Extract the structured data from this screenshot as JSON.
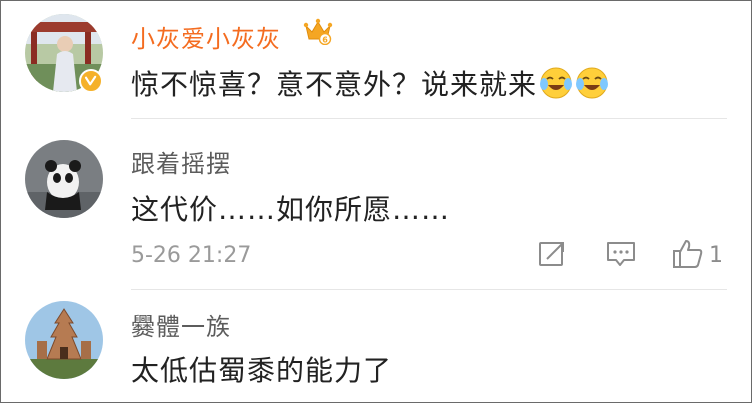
{
  "comments": [
    {
      "username": "小灰爱小灰灰",
      "username_color": "#f46c20",
      "text": "惊不惊喜？意不意外？说来就来",
      "emojis": [
        "laugh-cry-icon",
        "laugh-cry-icon"
      ],
      "verified_badge": "v-badge-icon",
      "vip_badge": "crown-icon"
    },
    {
      "username": "跟着摇摆",
      "username_color": "#5c5c5c",
      "text": "这代价……如你所愿……",
      "timestamp": "5-26 21:27",
      "actions": {
        "share_icon": "forward-icon",
        "comment_icon": "comment-icon",
        "like_icon": "thumbs-up-icon",
        "like_count": "1"
      }
    },
    {
      "username": "爨體一族",
      "username_color": "#5c5c5c",
      "text": "太低估蜀黍的能力了"
    }
  ]
}
